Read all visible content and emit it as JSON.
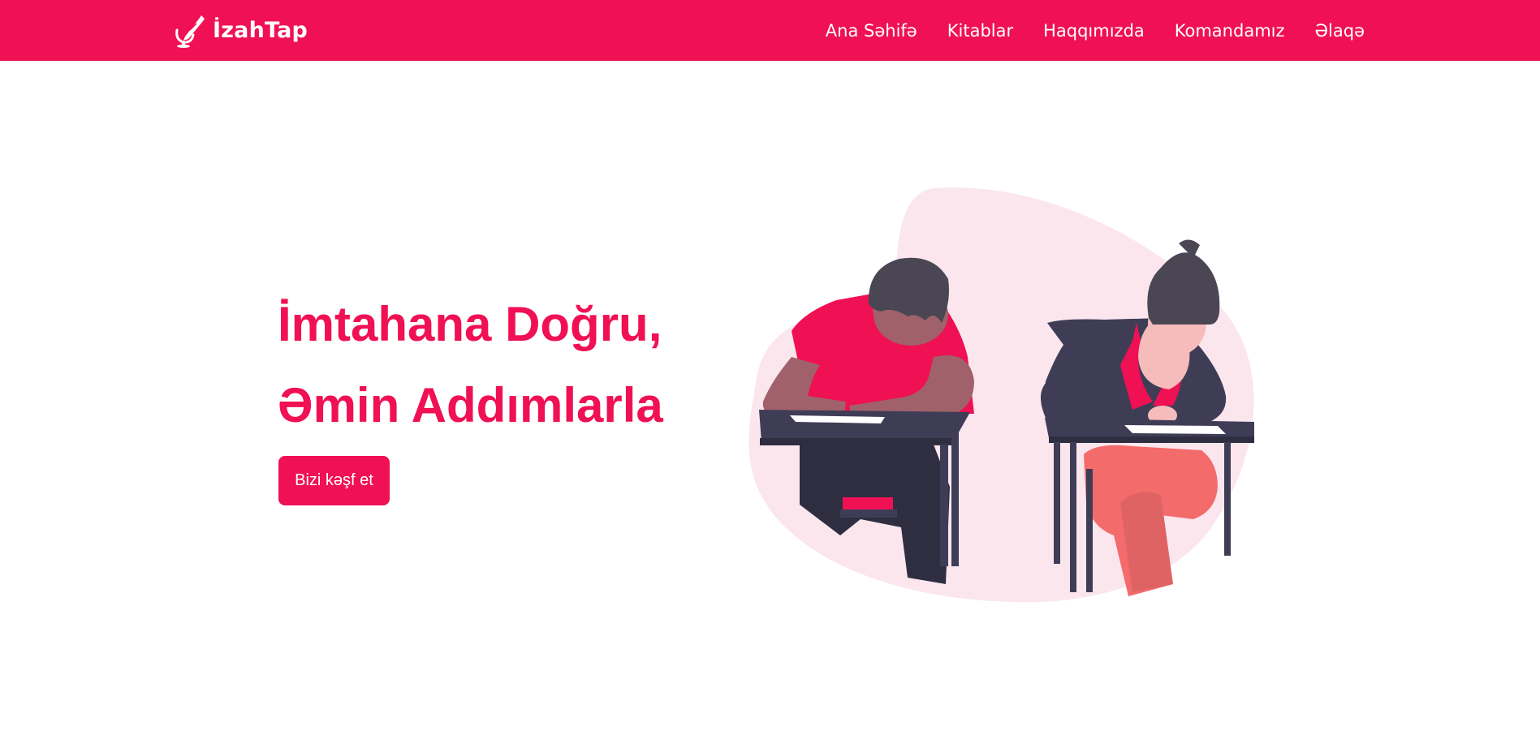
{
  "brand": {
    "name": "İzahTap",
    "logo_icon": "pencil-pot-icon"
  },
  "nav": {
    "items": [
      {
        "label": "Ana Səhifə"
      },
      {
        "label": "Kitablar"
      },
      {
        "label": "Haqqımızda"
      },
      {
        "label": "Komandamız"
      },
      {
        "label": "Əlaqə"
      }
    ]
  },
  "hero": {
    "title_line1": "İmtahana Doğru,",
    "title_line2": "Əmin Addımlarla",
    "cta_label": "Bizi kəşf et",
    "illustration": "students-taking-exam-illustration"
  },
  "colors": {
    "accent": "#f01054",
    "blob": "#fbe6ee",
    "dark": "#3f3d56",
    "hair": "#4a4653",
    "skin_dark": "#a0616a",
    "skin_light": "#f6bcbc",
    "coral": "#f36b6b"
  }
}
